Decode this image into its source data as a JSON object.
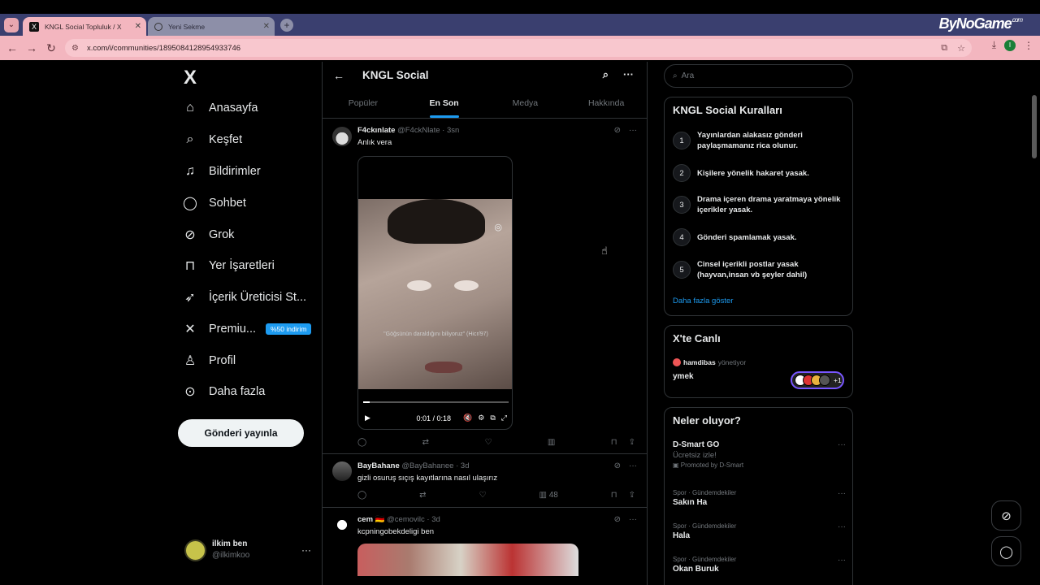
{
  "browser": {
    "tabs": [
      {
        "title": "KNGL Social Topluluk / X",
        "favicon": "X"
      },
      {
        "title": "Yeni Sekme"
      }
    ],
    "url": "x.com/i/communities/1895084128954933746",
    "profile_initial": "I",
    "brand": "ByNoGame",
    "brand_suffix": ".com",
    "accent": "#f3b6bf"
  },
  "nav": {
    "logo": "X",
    "items": [
      {
        "label": "Anasayfa",
        "icon": "home-icon"
      },
      {
        "label": "Keşfet",
        "icon": "search-icon"
      },
      {
        "label": "Bildirimler",
        "icon": "bell-icon"
      },
      {
        "label": "Sohbet",
        "icon": "chat-icon"
      },
      {
        "label": "Grok",
        "icon": "grok-icon"
      },
      {
        "label": "Yer İşaretleri",
        "icon": "bookmark-icon"
      },
      {
        "label": "İçerik Üreticisi St...",
        "icon": "rocket-icon"
      },
      {
        "label": "Premiu...",
        "icon": "x-icon"
      },
      {
        "label": "Profil",
        "icon": "person-icon"
      },
      {
        "label": "Daha fazla",
        "icon": "more-circle-icon"
      }
    ],
    "premium_badge": "%50 indirim",
    "post_button": "Gönderi yayınla",
    "user": {
      "name": "ilkim ben",
      "handle": "@ilkimkoo"
    }
  },
  "main": {
    "title": "KNGL Social",
    "tabs": [
      "Popüler",
      "En Son",
      "Medya",
      "Hakkında"
    ],
    "active_tab": "En Son",
    "posts": [
      {
        "name": "F4ckınlate",
        "handle": "@F4ckNlate",
        "time": "3sn",
        "text": "Anlık vera",
        "video": {
          "caption": "\"Göğsünün daraldığını biliyoruz\" (Hicr/97)",
          "time": "0:01 / 0:18"
        }
      },
      {
        "name": "BayBahane",
        "handle": "@BayBahanee",
        "time": "3d",
        "text": "gizli osuruş sıçış kayıtlarına nasıl ulaşırız",
        "views": "48"
      },
      {
        "name": "cem",
        "flag": "🇩🇪",
        "handle": "@cemovilc",
        "time": "3d",
        "text": "kcpningobekdeligi ben"
      }
    ]
  },
  "right": {
    "search_placeholder": "Ara",
    "rules_title": "KNGL Social Kuralları",
    "rules": [
      "Yayınlardan alakasız gönderi paylaşmamanız rica olunur.",
      "Kişilere yönelik hakaret yasak.",
      "Drama içeren drama yaratmaya yönelik içerikler yasak.",
      "Gönderi spamlamak yasak.",
      "Cinsel içerikli postlar yasak (hayvan,insan vb şeyler dahil)"
    ],
    "show_more": "Daha fazla göster",
    "live_title": "X'te Canlı",
    "live_host": "hamdibas",
    "live_host_suffix": "yönetiyor",
    "live_space": "ymek",
    "live_extra": "+1",
    "trends_title": "Neler oluyor?",
    "trends": [
      {
        "category": "",
        "title": "D-Smart GO",
        "sub": "Ücretsiz izle!",
        "promo": "Promoted by D-Smart"
      },
      {
        "category": "Spor · Gündemdekiler",
        "title": "Sakın Ha"
      },
      {
        "category": "Spor · Gündemdekiler",
        "title": "Hala"
      },
      {
        "category": "Spor · Gündemdekiler",
        "title": "Okan Buruk"
      }
    ]
  }
}
